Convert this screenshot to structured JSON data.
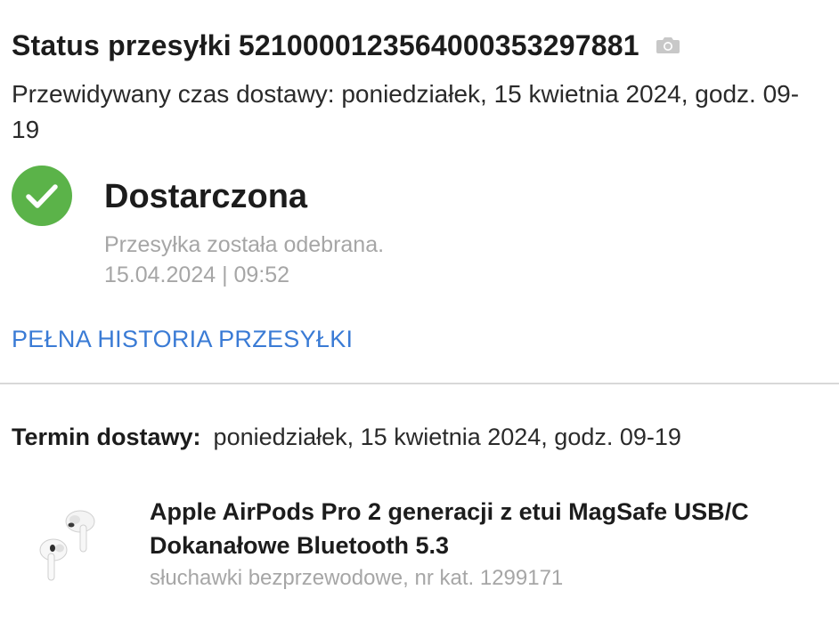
{
  "header": {
    "title_prefix": "Status przesyłki",
    "tracking_number": "5210000123564000353297881"
  },
  "eta": {
    "text": "Przewidywany czas dostawy: poniedziałek, 15 kwietnia 2024, godz. 09-19"
  },
  "status": {
    "label": "Dostarczona",
    "description": "Przesyłka została odebrana.",
    "timestamp": "15.04.2024 | 09:52",
    "color": "#5bb349"
  },
  "history_link": {
    "label": "PEŁNA HISTORIA PRZESYŁKI",
    "color": "#3a7bd5"
  },
  "delivery_term": {
    "label": "Termin dostawy:",
    "value": "poniedziałek, 15 kwietnia 2024, godz. 09-19"
  },
  "product": {
    "name": "Apple AirPods Pro 2 generacji z etui MagSafe USB/C Dokanałowe Bluetooth 5.3",
    "meta": "słuchawki bezprzewodowe, nr kat. 1299171",
    "image_icon": "earbuds-icon"
  },
  "icons": {
    "camera": "camera-icon",
    "status": "check-circle-icon"
  }
}
